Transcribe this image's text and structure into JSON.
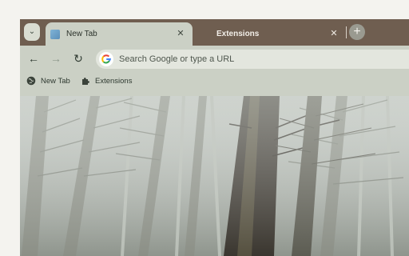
{
  "tabs": [
    {
      "title": "New Tab",
      "active": true
    },
    {
      "title": "Extensions",
      "active": false
    }
  ],
  "tab_controls": {
    "close_glyph": "✕",
    "new_tab_glyph": "+",
    "tab_search_glyph": "⌄"
  },
  "toolbar": {
    "back_glyph": "←",
    "forward_glyph": "→",
    "reload_glyph": "↻"
  },
  "omnibox": {
    "placeholder": "Search Google or type a URL"
  },
  "bookmarks": [
    {
      "label": "New Tab",
      "icon": "globe-icon"
    },
    {
      "label": "Extensions",
      "icon": "puzzle-icon"
    }
  ],
  "colors": {
    "tabstrip": "#6f5e50",
    "chrome": "#cbd0c5",
    "omnibox": "#e3e6de"
  },
  "content": {
    "background": "foggy pine forest photo"
  }
}
